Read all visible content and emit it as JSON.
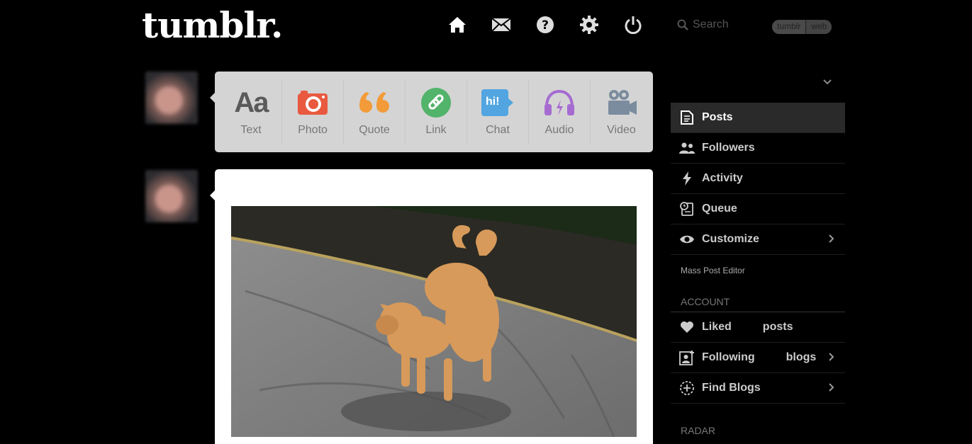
{
  "header": {
    "logo": "tumblr.",
    "search_placeholder": "Search",
    "toggle": [
      "tumblr",
      "web"
    ]
  },
  "nav_icons": [
    "home-icon",
    "mail-icon",
    "help-icon",
    "settings-icon",
    "power-icon"
  ],
  "post_types": [
    {
      "label": "Text",
      "icon": "text-icon",
      "color": "#5a5a5a"
    },
    {
      "label": "Photo",
      "icon": "camera-icon",
      "color": "#e8593f"
    },
    {
      "label": "Quote",
      "icon": "quote-icon",
      "color": "#f29b38"
    },
    {
      "label": "Link",
      "icon": "link-icon",
      "color": "#52b36a"
    },
    {
      "label": "Chat",
      "icon": "chat-icon",
      "color": "#52a5e0"
    },
    {
      "label": "Audio",
      "icon": "headphones-icon",
      "color": "#a66bd1"
    },
    {
      "label": "Video",
      "icon": "video-camera-icon",
      "color": "#7b8c9e"
    }
  ],
  "text_icon_glyph": "Aa",
  "chat_icon_glyph": "hi!",
  "sidebar": {
    "items": [
      {
        "label": "Posts"
      },
      {
        "label": "Followers"
      },
      {
        "label": "Activity"
      },
      {
        "label": "Queue"
      },
      {
        "label": "Customize"
      }
    ],
    "mass_post_editor": "Mass Post Editor",
    "account_title": "ACCOUNT",
    "account_items": [
      {
        "label": "Liked",
        "suffix": "posts"
      },
      {
        "label": "Following",
        "suffix": "blogs"
      },
      {
        "label": "Find Blogs"
      }
    ],
    "radar_title": "RADAR"
  }
}
